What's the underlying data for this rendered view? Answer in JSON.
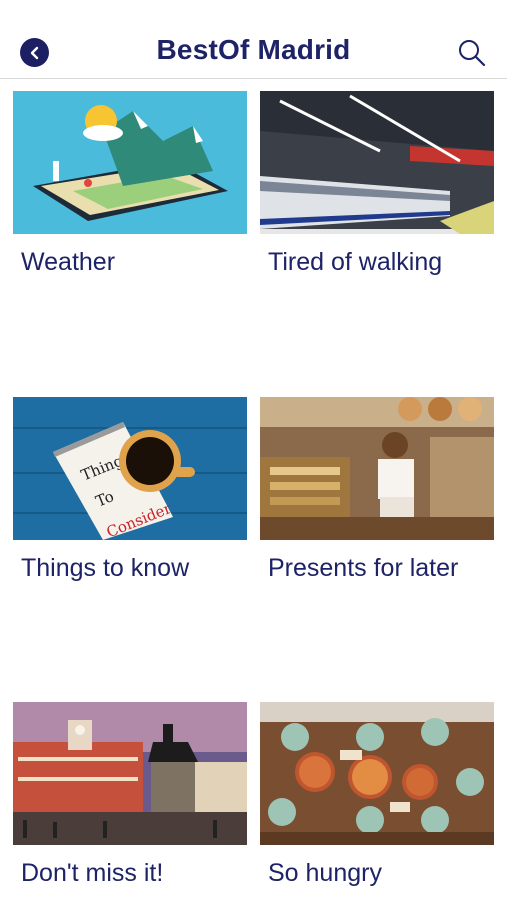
{
  "header": {
    "title": "BestOf Madrid",
    "back_icon": "chevron-left-icon",
    "search_icon": "search-icon"
  },
  "cards": [
    {
      "label": "Weather",
      "image": "weather-tablet-illustration"
    },
    {
      "label": "Tired of walking",
      "image": "metro-station-photo"
    },
    {
      "label": "Things to know",
      "image": "coffee-notepad-photo"
    },
    {
      "label": "Presents for later",
      "image": "market-stall-photo"
    },
    {
      "label": "Don't miss it!",
      "image": "puerta-del-sol-photo"
    },
    {
      "label": "So hungry",
      "image": "shared-meal-photo"
    }
  ],
  "colors": {
    "brand_navy": "#1d2366",
    "back_button": "#1d1f63"
  }
}
